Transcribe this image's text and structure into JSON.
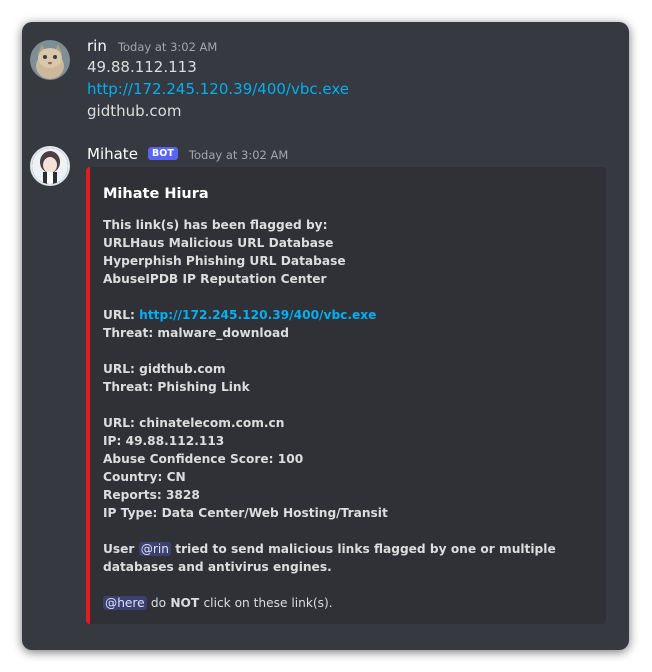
{
  "messages": [
    {
      "username": "rin",
      "timestamp": "Today at 3:02 AM",
      "lines": [
        "49.88.112.113",
        "http://172.245.120.39/400/vbc.exe",
        "gidthub.com"
      ]
    },
    {
      "username": "Mihate",
      "badge": "BOT",
      "timestamp": "Today at 3:02 AM",
      "embed": {
        "title": "Mihate Hiura",
        "flagged_intro": "This link(s) has been flagged by:",
        "databases": [
          "URLHaus Malicious URL Database",
          "Hyperphish Phishing URL Database",
          "AbuseIPDB IP Reputation Center"
        ],
        "entry1": {
          "url_label": "URL: ",
          "url": "http://172.245.120.39/400/vbc.exe",
          "threat": "Threat: malware_download"
        },
        "entry2": {
          "url": "URL: gidthub.com",
          "threat": "Threat: Phishing Link"
        },
        "entry3": {
          "url": "URL: chinatelecom.com.cn",
          "ip": "IP: 49.88.112.113",
          "score": "Abuse Confidence Score: 100",
          "country": "Country: CN",
          "reports": "Reports: 3828",
          "ip_type": "IP Type: Data Center/Web Hosting/Transit"
        },
        "warning_prefix": "User",
        "warning_mention": "@rin",
        "warning_suffix": "tried to send malicious links flagged by one or multiple databases and antivirus engines.",
        "here_mention": "@here",
        "do_text": "do",
        "not_text": "NOT",
        "click_text": "click on these link(s)."
      }
    }
  ],
  "colors": {
    "background": "#36393f",
    "embed_bg": "#2f3136",
    "embed_accent": "#e31c1c",
    "link": "#00aff4",
    "bot_badge": "#5865f2"
  }
}
